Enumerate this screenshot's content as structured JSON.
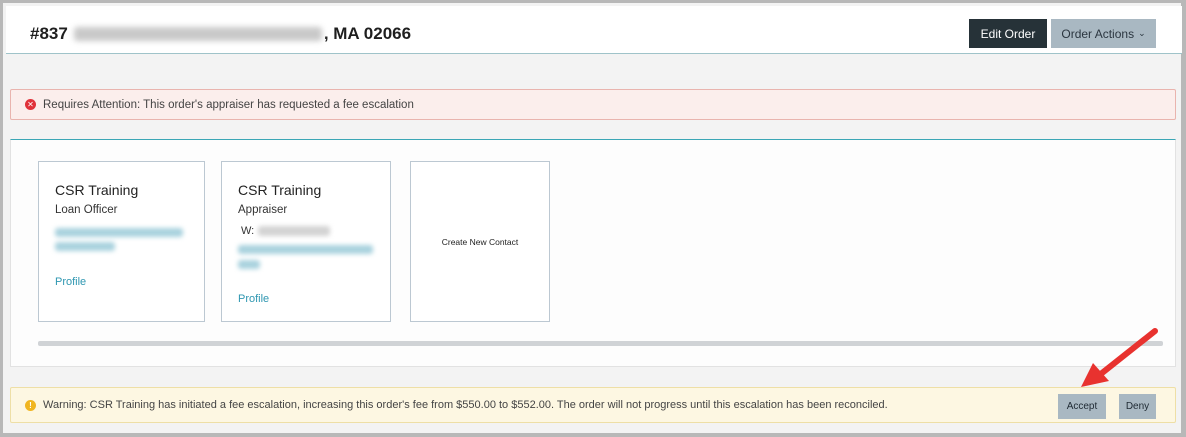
{
  "header": {
    "order_number": "#837",
    "address_suffix": ", MA 02066",
    "edit_order_label": "Edit Order",
    "order_actions_label": "Order Actions"
  },
  "attention_alert": {
    "text": "Requires Attention: This order's appraiser has requested a fee escalation",
    "icon": "error-circle-icon",
    "color": "#e0323a"
  },
  "contacts": [
    {
      "name": "CSR Training",
      "role": "Loan Officer",
      "profile_label": "Profile"
    },
    {
      "name": "CSR Training",
      "role": "Appraiser",
      "phone_label": "W:",
      "profile_label": "Profile"
    }
  ],
  "create_contact_label": "Create New Contact",
  "warning_alert": {
    "text": "Warning: CSR Training has initiated a fee escalation, increasing this order's fee from $550.00 to $552.00. The order will not progress until this escalation has been reconciled.",
    "icon": "warning-circle-icon",
    "color": "#f0b520",
    "accept_label": "Accept",
    "deny_label": "Deny"
  },
  "annotation": {
    "arrow_color": "#e8322f"
  }
}
